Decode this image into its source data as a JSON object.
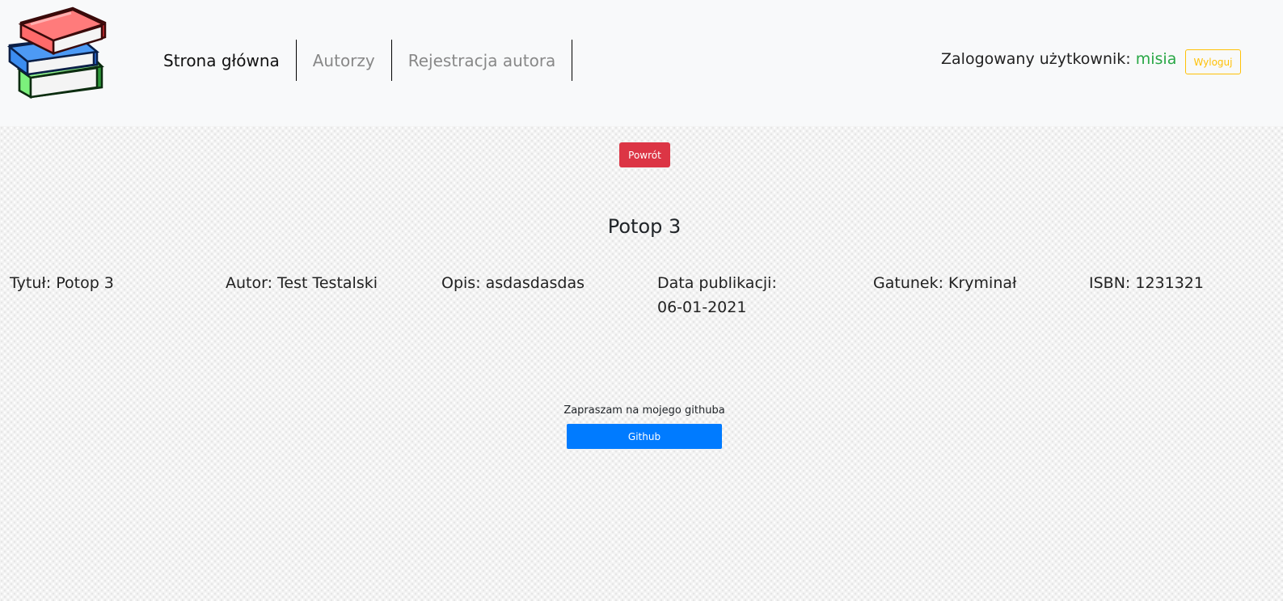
{
  "header": {
    "logo_icon": "books-stack-icon",
    "nav": [
      {
        "label": "Strona główna",
        "active": true
      },
      {
        "label": "Autorzy",
        "active": false
      },
      {
        "label": "Rejestracja autora",
        "active": false
      }
    ],
    "user_prefix": "Zalogowany użytkownik: ",
    "username": "misia",
    "logout_label": "Wyloguj"
  },
  "main": {
    "back_label": "Powrót",
    "title": "Potop 3",
    "details": {
      "title": "Tytuł: Potop 3",
      "author": "Autor: Test Testalski",
      "description": "Opis: asdasdasdas",
      "publication_label": "Data publikacji:",
      "publication_date": "06-01-2021",
      "genre": "Gatunek: Kryminał",
      "isbn": "ISBN: 1231321"
    }
  },
  "footer": {
    "text": "Zapraszam na mojego githuba",
    "github_label": "Github"
  },
  "colors": {
    "navbar_bg": "#f8f9fa",
    "username": "#28a745",
    "logout": "#ffc107",
    "back": "#dc3545",
    "github": "#007bff"
  }
}
